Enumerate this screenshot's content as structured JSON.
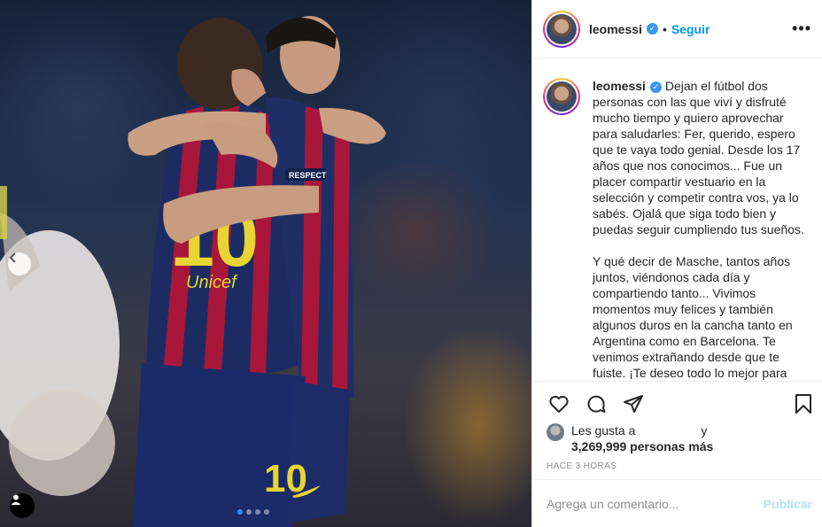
{
  "header": {
    "username": "leomessi",
    "separator": "•",
    "follow_label": "Seguir",
    "more_icon": "more-options-icon"
  },
  "caption": {
    "username": "leomessi",
    "paragraph1": "Dejan el fútbol dos personas con las que viví y disfruté mucho tiempo y quiero aprovechar para saludarles: Fer, querido, espero que te vaya todo genial. Desde los 17 años que nos conocimos... Fue un placer compartir vestuario en la selección y competir contra vos, ya lo sabés. Ojalá que siga todo bien y puedas seguir cumpliendo tus sueños.",
    "paragraph2": "Y qué decir de Masche, tantos años juntos, viéndonos cada día y compartiendo tanto... Vivimos momentos muy felices y también algunos duros en la cancha tanto en Argentina como en Barcelona. Te venimos extrañando desde que te fuiste. ¡Te deseo todo lo mejor para"
  },
  "actions": {
    "like_icon": "heart-icon",
    "comment_icon": "comment-icon",
    "share_icon": "share-icon",
    "save_icon": "bookmark-icon"
  },
  "likes": {
    "prefix": "Les gusta a",
    "conjunction": "y",
    "count_text": "3,269,999 personas más"
  },
  "timestamp": "Hace 3 horas",
  "comment_input": {
    "placeholder": "Agrega un comentario...",
    "post_label": "Publicar"
  },
  "media": {
    "carousel_count": 4,
    "active_index": 0,
    "jersey_number": "10",
    "jersey_number_shorts": "10",
    "sleeve_badge": "RESPECT",
    "sponsor": "Unicef",
    "nav_icon": "chevron-left-icon",
    "tag_icon": "user-tag-icon"
  },
  "colors": {
    "link_blue": "#0095f6",
    "verified_blue": "#3897f0",
    "post_disabled": "#b2dffc",
    "border": "#efefef"
  }
}
